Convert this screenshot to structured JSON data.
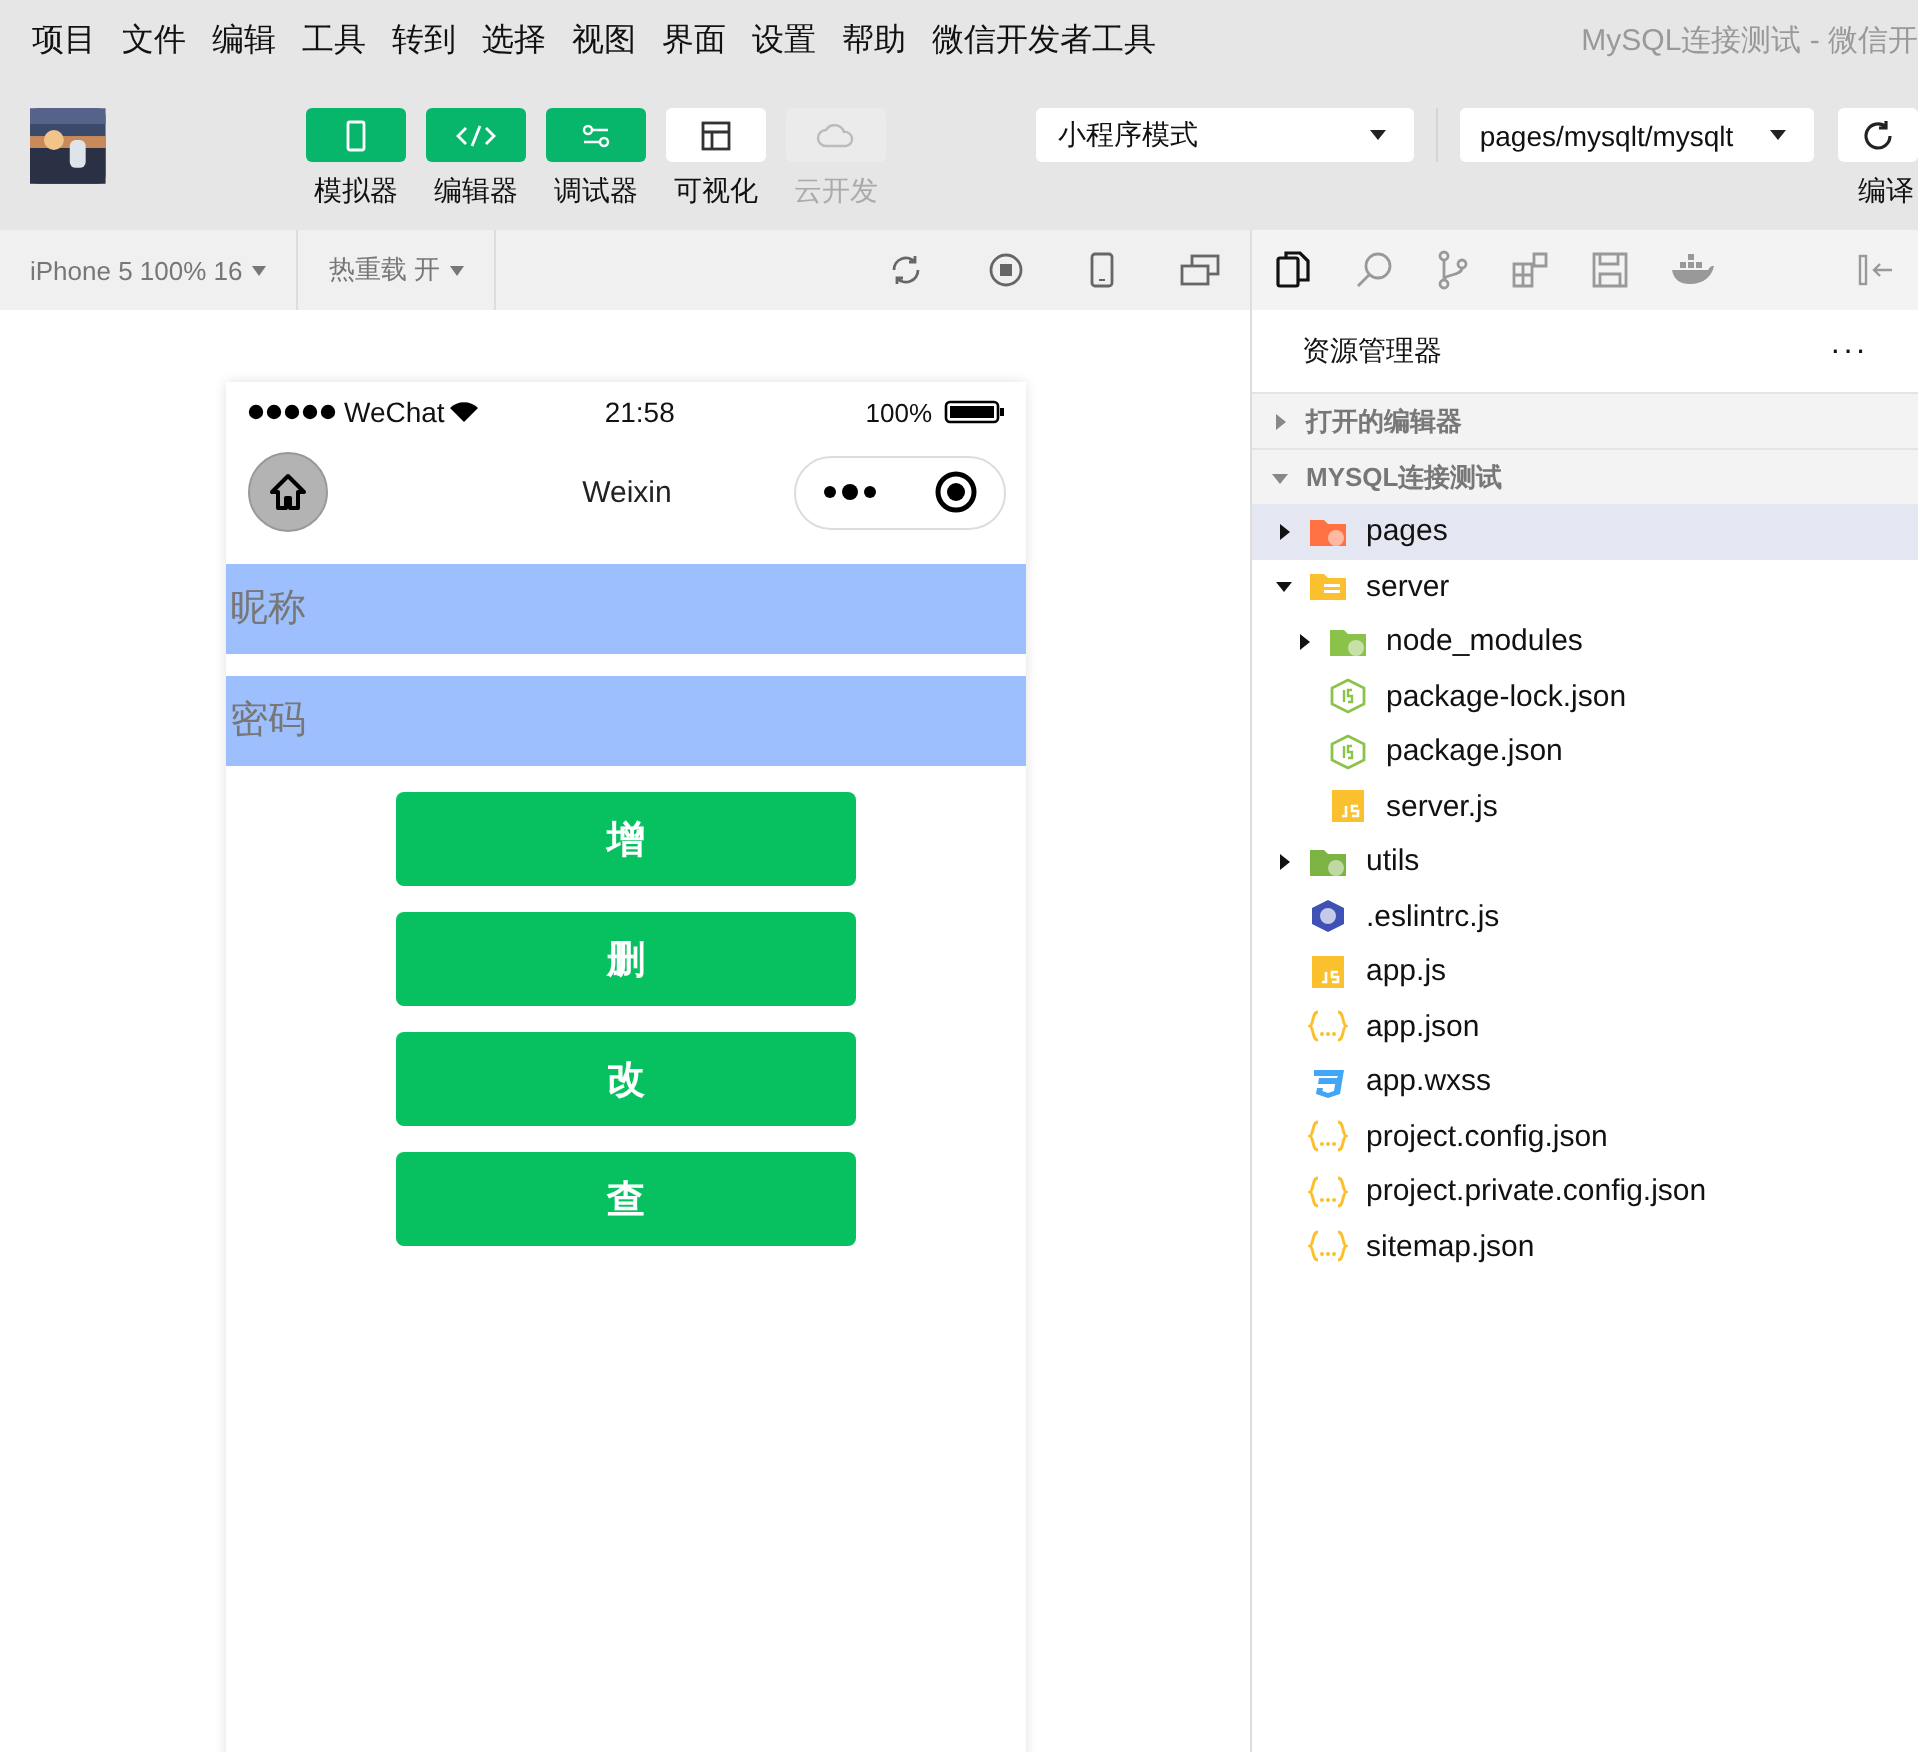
{
  "menu": [
    "项目",
    "文件",
    "编辑",
    "工具",
    "转到",
    "选择",
    "视图",
    "界面",
    "设置",
    "帮助",
    "微信开发者工具"
  ],
  "window": {
    "title": "MySQL连接测试 - 微信开"
  },
  "toolbar": {
    "tools": [
      {
        "kind": "phone",
        "label": "模拟器",
        "on": true,
        "disabled": false
      },
      {
        "kind": "code",
        "label": "编辑器",
        "on": true,
        "disabled": false
      },
      {
        "kind": "sliders",
        "label": "调试器",
        "on": true,
        "disabled": false
      },
      {
        "kind": "layout",
        "label": "可视化",
        "on": false,
        "disabled": false
      },
      {
        "kind": "cloud",
        "label": "云开发",
        "on": false,
        "disabled": true
      }
    ],
    "mode": "小程序模式",
    "page": "pages/mysqlt/mysqlt",
    "compile": "编译"
  },
  "simulator_bar": {
    "device": "iPhone 5 100% 16",
    "hot_reload": "热重载 开"
  },
  "phone": {
    "carrier": "WeChat",
    "time": "21:58",
    "battery": "100%",
    "nav_title": "Weixin",
    "inputs": [
      {
        "placeholder": "昵称"
      },
      {
        "placeholder": "密码"
      }
    ],
    "buttons": [
      "增",
      "删",
      "改",
      "查"
    ]
  },
  "explorer": {
    "title": "资源管理器",
    "more": "···",
    "sections": [
      {
        "title": "打开的编辑器",
        "expanded": false
      },
      {
        "title": "MYSQL连接测试",
        "expanded": true,
        "items": [
          {
            "name": "pages",
            "kind": "folder",
            "color": "#ff7043",
            "expanded": false,
            "selected": true
          },
          {
            "name": "server",
            "kind": "folder-open",
            "color": "#fbc02d",
            "expanded": true,
            "selected": false,
            "children": [
              {
                "name": "node_modules",
                "kind": "folder",
                "color": "#8bc34a",
                "expanded": false,
                "selected": false
              },
              {
                "name": "package-lock.json",
                "kind": "node",
                "selected": false
              },
              {
                "name": "package.json",
                "kind": "node",
                "selected": false
              },
              {
                "name": "server.js",
                "kind": "js",
                "selected": false
              }
            ]
          },
          {
            "name": "utils",
            "kind": "folder",
            "color": "#7cb342",
            "expanded": false,
            "selected": false
          },
          {
            "name": ".eslintrc.js",
            "kind": "eslint",
            "selected": false
          },
          {
            "name": "app.js",
            "kind": "js",
            "selected": false
          },
          {
            "name": "app.json",
            "kind": "json",
            "selected": false
          },
          {
            "name": "app.wxss",
            "kind": "css",
            "selected": false
          },
          {
            "name": "project.config.json",
            "kind": "json",
            "selected": false
          },
          {
            "name": "project.private.config.json",
            "kind": "json",
            "selected": false
          },
          {
            "name": "sitemap.json",
            "kind": "json",
            "selected": false
          }
        ]
      }
    ]
  }
}
